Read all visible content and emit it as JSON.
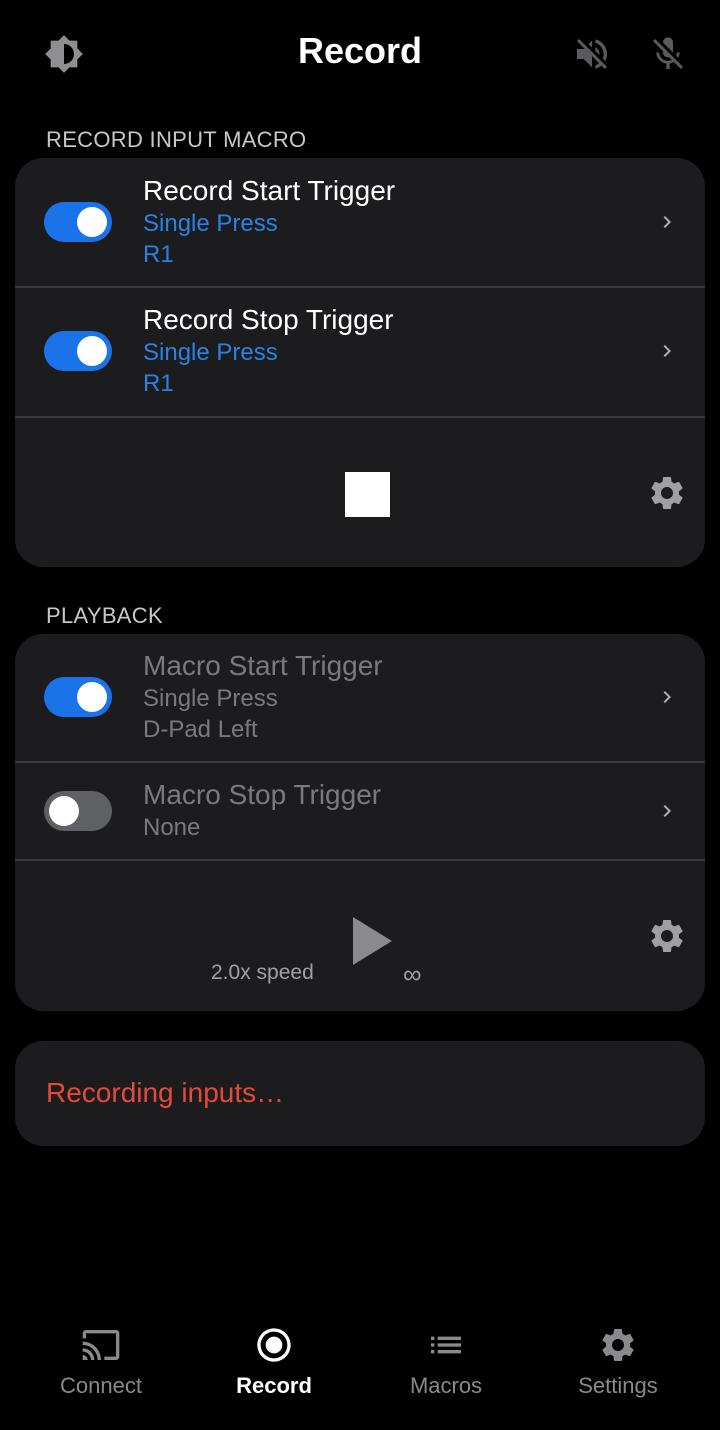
{
  "header": {
    "title": "Record",
    "icons": [
      "brightness-icon",
      "speaker-muted-icon",
      "mic-muted-icon"
    ]
  },
  "record_section": {
    "label": "RECORD INPUT MACRO",
    "start_trigger": {
      "title": "Record Start Trigger",
      "mode": "Single Press",
      "button": "R1",
      "enabled": true
    },
    "stop_trigger": {
      "title": "Record Stop Trigger",
      "mode": "Single Press",
      "button": "R1",
      "enabled": true
    }
  },
  "playback_section": {
    "label": "PLAYBACK",
    "start_trigger": {
      "title": "Macro Start Trigger",
      "mode": "Single Press",
      "button": "D-Pad Left",
      "enabled": true
    },
    "stop_trigger": {
      "title": "Macro Stop Trigger",
      "mode": "None",
      "enabled": false
    },
    "speed": "2.0x speed",
    "loop": "∞"
  },
  "status": {
    "text": "Recording inputs…"
  },
  "nav": {
    "items": [
      {
        "label": "Connect",
        "icon": "cast-icon",
        "active": false
      },
      {
        "label": "Record",
        "icon": "record-icon",
        "active": true
      },
      {
        "label": "Macros",
        "icon": "list-icon",
        "active": false
      },
      {
        "label": "Settings",
        "icon": "gear-icon",
        "active": false
      }
    ]
  },
  "colors": {
    "background": "#000000",
    "card": "#1c1c1e",
    "accent_blue": "#2a82e4",
    "toggle_on": "#1a73e8",
    "status_red": "#e5493a"
  }
}
